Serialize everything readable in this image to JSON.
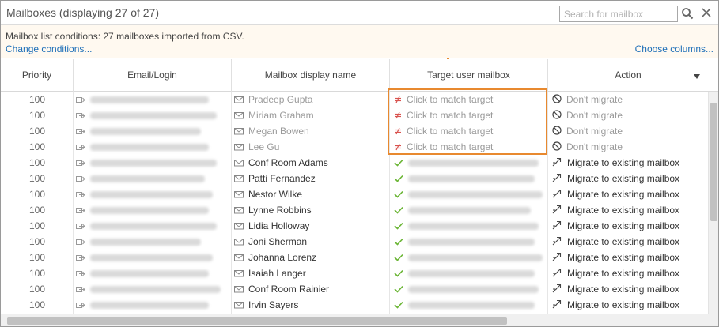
{
  "window": {
    "title": "Mailboxes (displaying 27 of 27)"
  },
  "search": {
    "placeholder": "Search for mailbox"
  },
  "conditions": {
    "text": "Mailbox list conditions: 27 mailboxes imported from CSV.",
    "change_link": "Change conditions...",
    "choose_columns_link": "Choose columns..."
  },
  "columns": [
    "Priority",
    "Email/Login",
    "Mailbox display name",
    "Target user mailbox",
    "Action"
  ],
  "icons": {
    "search": "search-icon",
    "close": "close-icon",
    "column_menu": "triangle-down-icon",
    "email": "arrow-right-box-icon",
    "mailbox": "envelope-icon",
    "unmatched": "not-equal-icon",
    "matched": "check-icon",
    "dont_migrate": "prohibit-icon",
    "migrate": "migrate-arrows-icon"
  },
  "colors": {
    "highlight": "#e8892f",
    "link": "#1e6fb8",
    "unmatched": "#d9534f",
    "matched": "#6ab534"
  },
  "rows": [
    {
      "priority": "100",
      "display_name": "Pradeep Gupta",
      "target": "Click to match target",
      "action": "Don't migrate",
      "matched": false
    },
    {
      "priority": "100",
      "display_name": "Miriam Graham",
      "target": "Click to match target",
      "action": "Don't migrate",
      "matched": false
    },
    {
      "priority": "100",
      "display_name": "Megan Bowen",
      "target": "Click to match target",
      "action": "Don't migrate",
      "matched": false
    },
    {
      "priority": "100",
      "display_name": "Lee Gu",
      "target": "Click to match target",
      "action": "Don't migrate",
      "matched": false
    },
    {
      "priority": "100",
      "display_name": "Conf Room Adams",
      "target": "",
      "action": "Migrate to existing mailbox",
      "matched": true
    },
    {
      "priority": "100",
      "display_name": "Patti Fernandez",
      "target": "",
      "action": "Migrate to existing mailbox",
      "matched": true
    },
    {
      "priority": "100",
      "display_name": "Nestor Wilke",
      "target": "",
      "action": "Migrate to existing mailbox",
      "matched": true
    },
    {
      "priority": "100",
      "display_name": "Lynne Robbins",
      "target": "",
      "action": "Migrate to existing mailbox",
      "matched": true
    },
    {
      "priority": "100",
      "display_name": "Lidia Holloway",
      "target": "",
      "action": "Migrate to existing mailbox",
      "matched": true
    },
    {
      "priority": "100",
      "display_name": "Joni Sherman",
      "target": "",
      "action": "Migrate to existing mailbox",
      "matched": true
    },
    {
      "priority": "100",
      "display_name": "Johanna Lorenz",
      "target": "",
      "action": "Migrate to existing mailbox",
      "matched": true
    },
    {
      "priority": "100",
      "display_name": "Isaiah Langer",
      "target": "",
      "action": "Migrate to existing mailbox",
      "matched": true
    },
    {
      "priority": "100",
      "display_name": "Conf Room Rainier",
      "target": "",
      "action": "Migrate to existing mailbox",
      "matched": true
    },
    {
      "priority": "100",
      "display_name": "Irvin Sayers",
      "target": "",
      "action": "Migrate to existing mailbox",
      "matched": true
    }
  ]
}
